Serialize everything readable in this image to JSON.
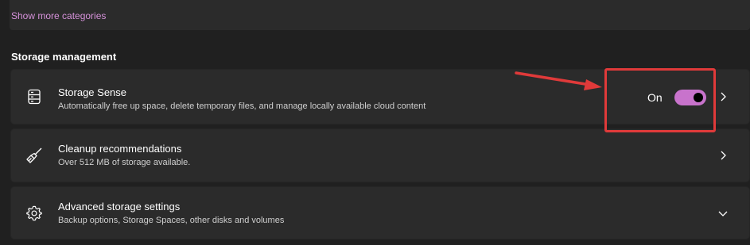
{
  "top": {
    "show_more_label": "Show more categories"
  },
  "section": {
    "title": "Storage management"
  },
  "cards": [
    {
      "title": "Storage Sense",
      "description": "Automatically free up space, delete temporary files, and manage locally available cloud content",
      "icon": "storage-icon",
      "toggle_state": "On",
      "toggle_on": true
    },
    {
      "title": "Cleanup recommendations",
      "description": "Over 512 MB of storage available.",
      "icon": "broom-icon"
    },
    {
      "title": "Advanced storage settings",
      "description": "Backup options, Storage Spaces, other disks and volumes",
      "icon": "gear-icon"
    }
  ],
  "colors": {
    "accent": "#c873cc",
    "link": "#d591d9",
    "annotation": "#e03a3a",
    "background": "#202020",
    "card": "#2b2b2b"
  }
}
